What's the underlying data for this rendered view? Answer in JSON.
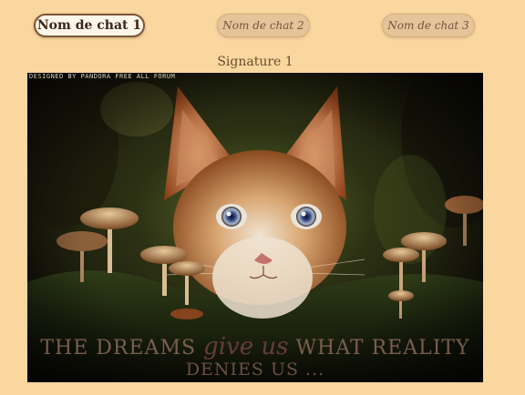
{
  "tabs": [
    {
      "label": "Nom de chat 1",
      "active": true
    },
    {
      "label": "Nom de chat 2",
      "active": false
    },
    {
      "label": "Nom de chat 3",
      "active": false
    }
  ],
  "signature": {
    "title": "Signature 1",
    "credit": "Designed by Pandora Free All Forum",
    "quote_start": "THE DREAMS",
    "quote_mid": "give us",
    "quote_end": "WHAT REALITY",
    "quote_line2": "DENIES US ...",
    "image": "cat-and-mushrooms-artwork"
  },
  "colors": {
    "background": "#fbd7a0",
    "active_tab_border": "#7b5637",
    "inactive_tab_fill": "#e6c49a",
    "title_text": "#6b4a2a"
  }
}
